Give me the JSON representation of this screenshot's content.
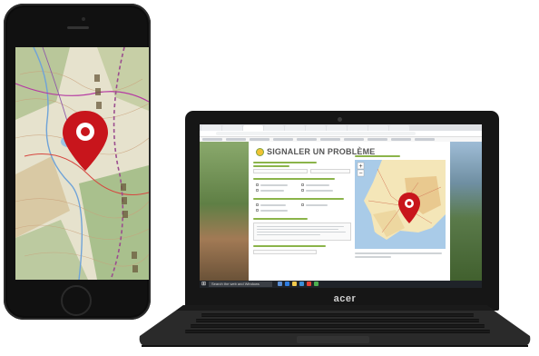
{
  "website": {
    "title": "SIGNALER UN PROBLÈME",
    "map_zoom_in": "+",
    "map_zoom_out": "−"
  },
  "taskbar": {
    "search_placeholder": "Search the web and Windows"
  },
  "laptop": {
    "brand_logo": "acer"
  },
  "colors": {
    "pin_red": "#c8151c",
    "accent_green": "#8bb44a",
    "page_title_gray": "#555555"
  }
}
